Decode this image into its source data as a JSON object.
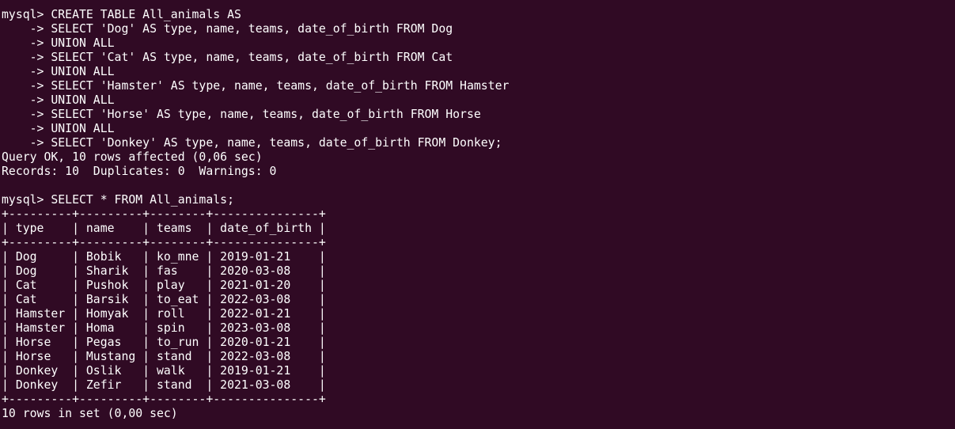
{
  "terminal": {
    "lines": [
      "mysql> CREATE TABLE All_animals AS",
      "    -> SELECT 'Dog' AS type, name, teams, date_of_birth FROM Dog",
      "    -> UNION ALL",
      "    -> SELECT 'Cat' AS type, name, teams, date_of_birth FROM Cat",
      "    -> UNION ALL",
      "    -> SELECT 'Hamster' AS type, name, teams, date_of_birth FROM Hamster",
      "    -> UNION ALL",
      "    -> SELECT 'Horse' AS type, name, teams, date_of_birth FROM Horse",
      "    -> UNION ALL",
      "    -> SELECT 'Donkey' AS type, name, teams, date_of_birth FROM Donkey;",
      "Query OK, 10 rows affected (0,06 sec)",
      "Records: 10  Duplicates: 0  Warnings: 0",
      "",
      "mysql> SELECT * FROM All_animals;",
      "+---------+---------+--------+---------------+",
      "| type    | name    | teams  | date_of_birth |",
      "+---------+---------+--------+---------------+",
      "| Dog     | Bobik   | ko_mne | 2019-01-21    |",
      "| Dog     | Sharik  | fas    | 2020-03-08    |",
      "| Cat     | Pushok  | play   | 2021-01-20    |",
      "| Cat     | Barsik  | to_eat | 2022-03-08    |",
      "| Hamster | Homyak  | roll   | 2022-01-21    |",
      "| Hamster | Homa    | spin   | 2023-03-08    |",
      "| Horse   | Pegas   | to_run | 2020-01-21    |",
      "| Horse   | Mustang | stand  | 2022-03-08    |",
      "| Donkey  | Oslik   | walk   | 2019-01-21    |",
      "| Donkey  | Zefir   | stand  | 2021-03-08    |",
      "+---------+---------+--------+---------------+",
      "10 rows in set (0,00 sec)"
    ]
  }
}
